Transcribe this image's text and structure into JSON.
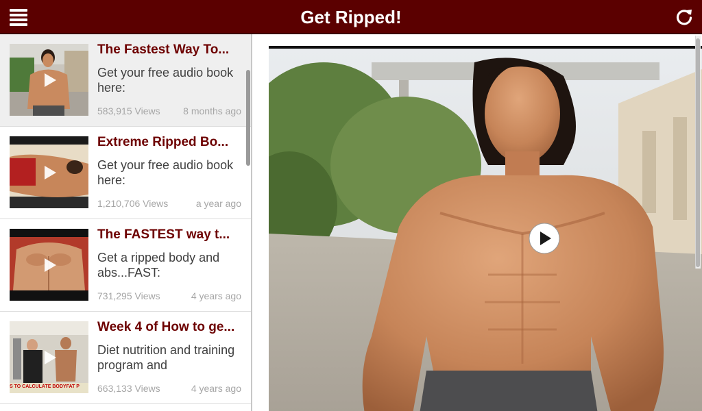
{
  "header": {
    "title": "Get Ripped!",
    "background_color": "#5b0000",
    "menu_icon": "hamburger-menu-icon",
    "refresh_icon": "refresh-icon"
  },
  "videos": [
    {
      "title": "The Fastest Way To...",
      "description": "Get your free audio book here:",
      "views": "583,915 Views",
      "age": "8 months ago",
      "selected": true
    },
    {
      "title": "Extreme Ripped Bo...",
      "description": "Get your free audio book here:",
      "views": "1,210,706 Views",
      "age": "a year ago",
      "selected": false
    },
    {
      "title": "The FASTEST way t...",
      "description": "Get a ripped body and abs...FAST:",
      "views": "731,295 Views",
      "age": "4 years ago",
      "selected": false
    },
    {
      "title": "Week 4 of How to ge...",
      "description": "Diet nutrition and training program and",
      "views": "663,133 Views",
      "age": "4 years ago",
      "selected": false
    }
  ],
  "thumbnail_banner": "S TO CALCULATE BODYFAT P",
  "colors": {
    "accent": "#5b0000",
    "title_text": "#6d0000",
    "meta_text": "#a6a6a6"
  }
}
